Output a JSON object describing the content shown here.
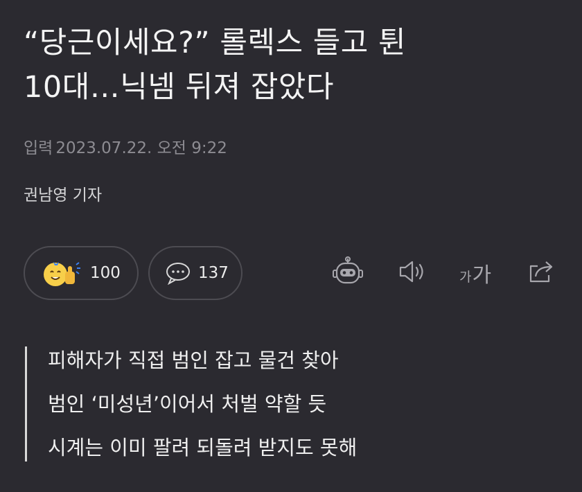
{
  "article": {
    "headline_line1": "“당근이세요?” 롤렉스 들고 튄",
    "headline_line2": "10대…닉넴 뒤져 잡았다",
    "published_label": "입력",
    "published_at": "2023.07.22. 오전 9:22",
    "reporter": "권남영 기자"
  },
  "reactions": {
    "react_icon": "smiley-thumbs-up-icon",
    "react_count": "100",
    "comment_icon": "speech-bubble-icon",
    "comment_count": "137"
  },
  "toolbar": {
    "summary_bot_icon": "robot-icon",
    "tts_icon": "speaker-icon",
    "font_size_small": "가",
    "font_size_large": "가",
    "share_icon": "share-icon"
  },
  "summary": {
    "lines": [
      "피해자가 직접 범인 잡고 물건 찾아",
      "범인 ‘미성년’이어서 처벌 약할 듯",
      "시계는 이미 팔려 되돌려 받지도 못해"
    ]
  },
  "colors": {
    "background": "#2b2a30",
    "pill_border": "#4d4c52",
    "muted_text": "#8d8c92",
    "emoji_yellow": "#f7cf4a",
    "emoji_blue": "#3b82f6"
  }
}
